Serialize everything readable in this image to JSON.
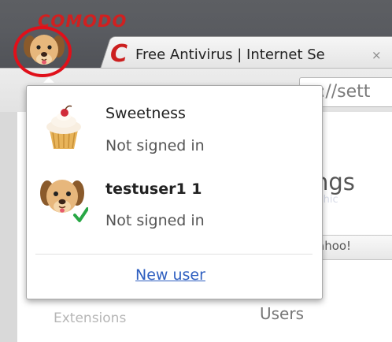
{
  "browser": {
    "brand": "COMODO",
    "tab": {
      "title": "Free Antivirus | Internet Se",
      "close_glyph": "×",
      "logo_glyph": "C"
    },
    "address_bar_text": "n://sett"
  },
  "page": {
    "heading": "ngs",
    "link_text": "whic",
    "button_label": "ahoo!",
    "left_nav_item": "Extensions",
    "section_title": "Users"
  },
  "profile_menu": {
    "profiles": [
      {
        "name": "Sweetness",
        "status": "Not signed in",
        "avatar_icon": "cupcake-icon",
        "selected": false
      },
      {
        "name": "testuser1 1",
        "status": "Not signed in",
        "avatar_icon": "dog-avatar-icon",
        "selected": true
      }
    ],
    "new_user_link": "New user"
  },
  "colors": {
    "highlight_ring": "#e0101a",
    "brand_red": "#d02020",
    "link_blue": "#2f5fc0",
    "check_green": "#28a745"
  }
}
